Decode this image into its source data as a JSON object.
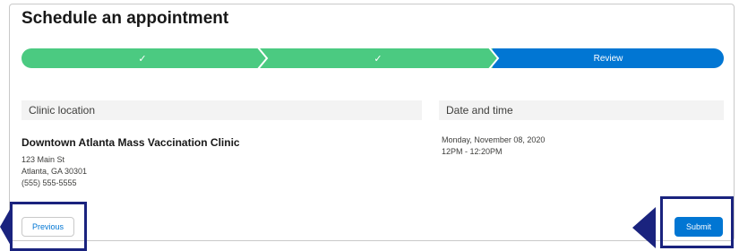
{
  "page": {
    "title": "Schedule an appointment"
  },
  "path": {
    "steps": [
      {
        "label": "✓",
        "state": "complete"
      },
      {
        "label": "✓",
        "state": "complete"
      },
      {
        "label": "Review",
        "state": "current"
      }
    ],
    "colors": {
      "complete": "#4bca81",
      "current": "#0176d3"
    }
  },
  "location": {
    "header": "Clinic location",
    "name": "Downtown Atlanta Mass Vaccination Clinic",
    "street": "123 Main St",
    "city": "Atlanta, GA 30301",
    "phone": "(555) 555-5555"
  },
  "datetime": {
    "header": "Date and time",
    "date": "Monday, November 08, 2020",
    "time": "12PM - 12:20PM"
  },
  "actions": {
    "previous_label": "Previous",
    "submit_label": "Submit"
  },
  "annotations": {
    "highlight_color": "#1a237e"
  }
}
